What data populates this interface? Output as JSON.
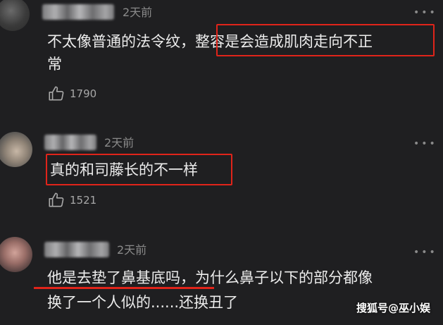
{
  "comments": [
    {
      "time": "2天前",
      "more": "•••",
      "line1_plain": "不太像普通的法令纹，",
      "line1_highlight": "整容是会造成肌肉走向不正",
      "line2_highlight": "常",
      "likes": "1790"
    },
    {
      "time": "2天前",
      "more": "•••",
      "line1_highlight": "真的和司藤长的不一样",
      "likes": "1521"
    },
    {
      "time": "2天前",
      "more": "•••",
      "line1_highlight": "他是去垫了鼻基底吗",
      "line1_plain": "，为什么鼻子以下的部分都像",
      "line2_plain": "换了一个人似的......还换丑了"
    }
  ],
  "watermark": "搜狐号@巫小娱",
  "colors": {
    "background": "#1f1f21",
    "text": "#ececec",
    "muted": "#8a8a8a",
    "highlight_red": "#e0241a"
  },
  "icons": [
    "thumbs-up-icon",
    "more-dots-icon"
  ]
}
